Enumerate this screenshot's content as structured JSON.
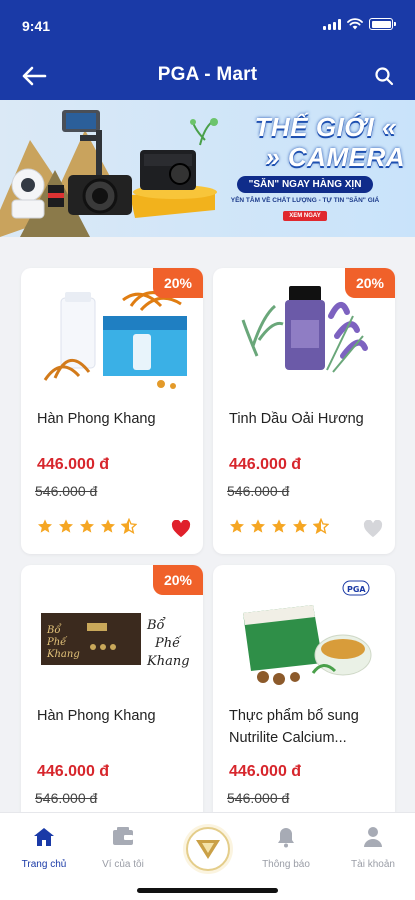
{
  "status_bar": {
    "time": "9:41"
  },
  "header": {
    "title": "PGA - Mart"
  },
  "banner": {
    "line1": "THẾ GIỚI «",
    "line2": "» CAMERA",
    "badge": "\"SĂN\" NGAY HÀNG XỊN",
    "tagline": "YÊN TÂM VỀ CHẤT LƯỢNG - TỰ TIN \"SĂN\" GIÁ",
    "cta": "XEM NGAY"
  },
  "products": [
    {
      "name": "Hàn Phong Khang",
      "price": "446.000 đ",
      "old_price": "546.000 đ",
      "discount": "20%",
      "rating": 4.5,
      "favorited": true
    },
    {
      "name": "Tinh Dầu Oải Hương",
      "price": "446.000 đ",
      "old_price": "546.000 đ",
      "discount": "20%",
      "rating": 4.5,
      "favorited": false
    },
    {
      "name": "Hàn Phong Khang",
      "price": "446.000 đ",
      "old_price": "546.000 đ",
      "discount": "20%"
    },
    {
      "name": "Thực phẩm bổ sung Nutrilite Calcium...",
      "price": "446.000 đ",
      "old_price": "546.000 đ"
    }
  ],
  "bottom_nav": {
    "items": [
      {
        "label": "Trang chủ",
        "icon": "home-icon",
        "active": true
      },
      {
        "label": "Ví của tôi",
        "icon": "wallet-icon"
      },
      {
        "label": "",
        "icon": "brand-logo-icon"
      },
      {
        "label": "Thông báo",
        "icon": "bell-icon"
      },
      {
        "label": "Tài khoản",
        "icon": "user-icon"
      }
    ]
  },
  "colors": {
    "primary": "#1a3aa7",
    "price": "#d7262c",
    "discount": "#f0612a",
    "star": "#f5a623",
    "heart_active": "#e0202b",
    "heart_inactive": "#d5d6da"
  }
}
